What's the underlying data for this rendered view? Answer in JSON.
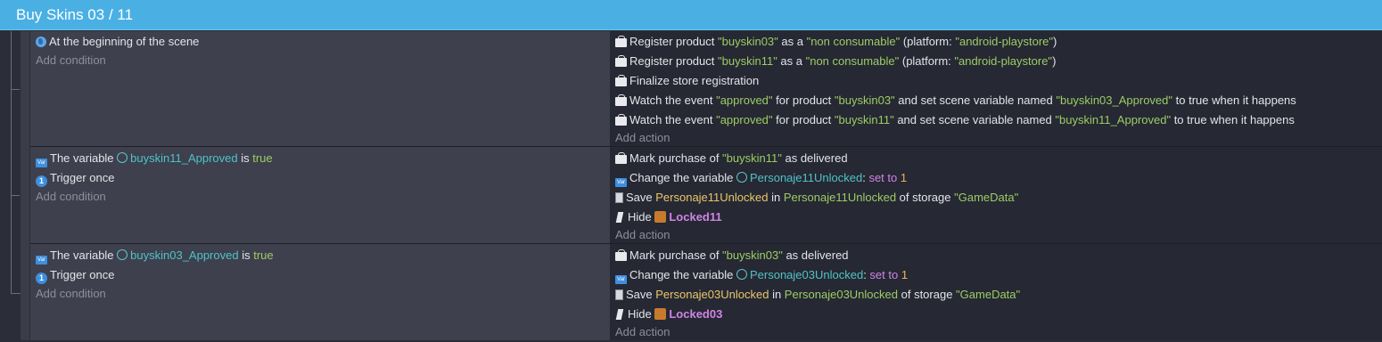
{
  "header": {
    "title": "Buy Skins 03 / 11"
  },
  "events": [
    {
      "conditions": [
        {
          "text": "At the beginning of the scene"
        }
      ],
      "add_condition": "Add condition",
      "actions": {
        "reg1": {
          "a": "Register product ",
          "b": "\"buyskin03\"",
          "c": " as a ",
          "d": "\"non consumable\"",
          "e": " (platform: ",
          "f": "\"android-playstore\"",
          "g": ")"
        },
        "reg2": {
          "a": "Register product ",
          "b": "\"buyskin11\"",
          "c": " as a ",
          "d": "\"non consumable\"",
          "e": " (platform: ",
          "f": "\"android-playstore\"",
          "g": ")"
        },
        "finalize": "Finalize store registration",
        "watch1": {
          "a": "Watch the event ",
          "b": "\"approved\"",
          "c": " for product ",
          "d": "\"buyskin03\"",
          "e": " and set scene variable named ",
          "f": "\"buyskin03_Approved\"",
          "g": " to true when it happens"
        },
        "watch2": {
          "a": "Watch the event ",
          "b": "\"approved\"",
          "c": " for product ",
          "d": "\"buyskin11\"",
          "e": " and set scene variable named ",
          "f": "\"buyskin11_Approved\"",
          "g": " to true when it happens"
        }
      },
      "add_action": "Add action"
    },
    {
      "conditions": {
        "var": {
          "a": "The variable ",
          "b": "buyskin11_Approved",
          "c": " is ",
          "d": "true"
        },
        "once": "Trigger once"
      },
      "add_condition": "Add condition",
      "actions": {
        "mark": {
          "a": "Mark purchase of ",
          "b": "\"buyskin11\"",
          "c": " as delivered"
        },
        "change": {
          "a": "Change the variable ",
          "b": "Personaje11Unlocked",
          "c": ": ",
          "d": "set to",
          "e": " 1"
        },
        "save": {
          "a": "Save ",
          "b": "Personaje11Unlocked",
          "c": " in ",
          "d": "Personaje11Unlocked",
          "e": " of storage ",
          "f": "\"GameData\""
        },
        "hide": {
          "a": "Hide ",
          "b": "Locked11"
        }
      },
      "add_action": "Add action"
    },
    {
      "conditions": {
        "var": {
          "a": "The variable ",
          "b": "buyskin03_Approved",
          "c": " is ",
          "d": "true"
        },
        "once": "Trigger once"
      },
      "add_condition": "Add condition",
      "actions": {
        "mark": {
          "a": "Mark purchase of ",
          "b": "\"buyskin03\"",
          "c": " as delivered"
        },
        "change": {
          "a": "Change the variable ",
          "b": "Personaje03Unlocked",
          "c": ": ",
          "d": "set to",
          "e": " 1"
        },
        "save": {
          "a": "Save ",
          "b": "Personaje03Unlocked",
          "c": " in ",
          "d": "Personaje03Unlocked",
          "e": " of storage ",
          "f": "\"GameData\""
        },
        "hide": {
          "a": "Hide ",
          "b": "Locked03"
        }
      },
      "add_action": "Add action"
    }
  ]
}
